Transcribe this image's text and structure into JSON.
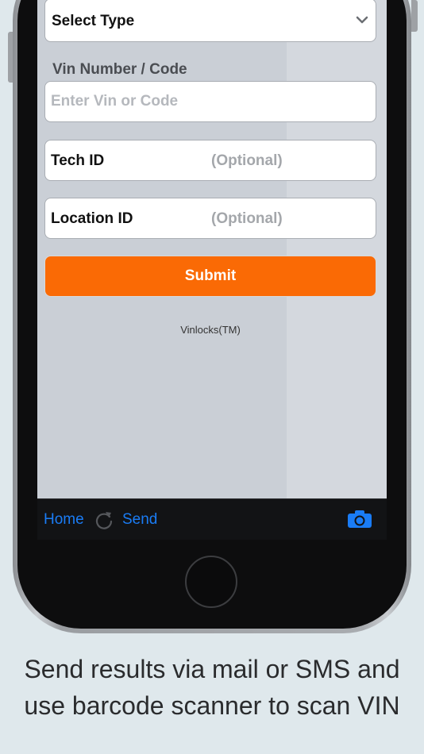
{
  "form": {
    "select_type_label": "Select Type",
    "vin_section_label": "Vin Number / Code",
    "vin_placeholder": "Enter Vin or Code",
    "tech_id_label": "Tech ID",
    "tech_id_hint": "(Optional)",
    "location_id_label": "Location ID",
    "location_id_hint": "(Optional)",
    "submit_label": "Submit",
    "trademark": "Vinlocks(TM)"
  },
  "toolbar": {
    "home_label": "Home",
    "refresh_icon": "refresh-icon",
    "send_label": "Send",
    "camera_icon": "camera-icon"
  },
  "caption": {
    "line1": "Send results via mail or SMS and",
    "line2": "use barcode scanner to scan VIN"
  },
  "colors": {
    "accent_orange": "#fa6a05",
    "link_blue": "#1a7cf5",
    "screen_bg": "#cacfd6",
    "page_bg": "#dfe8ec"
  }
}
